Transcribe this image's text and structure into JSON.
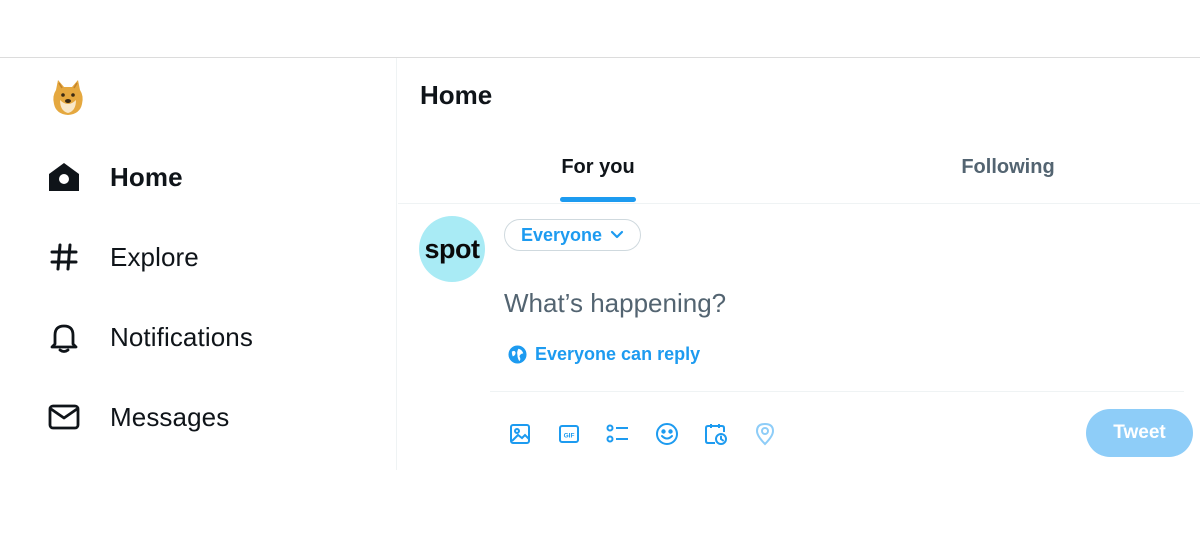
{
  "sidebar": {
    "logo_icon": "doge-logo-icon",
    "items": [
      {
        "label": "Home",
        "icon": "home-icon",
        "active": true
      },
      {
        "label": "Explore",
        "icon": "hashtag-icon",
        "active": false
      },
      {
        "label": "Notifications",
        "icon": "bell-icon",
        "active": false
      },
      {
        "label": "Messages",
        "icon": "envelope-icon",
        "active": false
      }
    ]
  },
  "main": {
    "title": "Home",
    "tabs": [
      {
        "label": "For you",
        "active": true
      },
      {
        "label": "Following",
        "active": false
      }
    ]
  },
  "composer": {
    "avatar_text": "spot",
    "avatar_color": "#a9ebf5",
    "audience_label": "Everyone",
    "placeholder": "What’s happening?",
    "reply_setting": "Everyone can reply",
    "tools": [
      "media-icon",
      "gif-icon",
      "poll-icon",
      "emoji-icon",
      "schedule-icon",
      "location-icon"
    ],
    "tweet_label": "Tweet"
  },
  "colors": {
    "accent": "#1d9bf0",
    "tweet_button_disabled": "#8ecdf8",
    "text_primary": "#0f1419",
    "text_secondary": "#536471"
  }
}
